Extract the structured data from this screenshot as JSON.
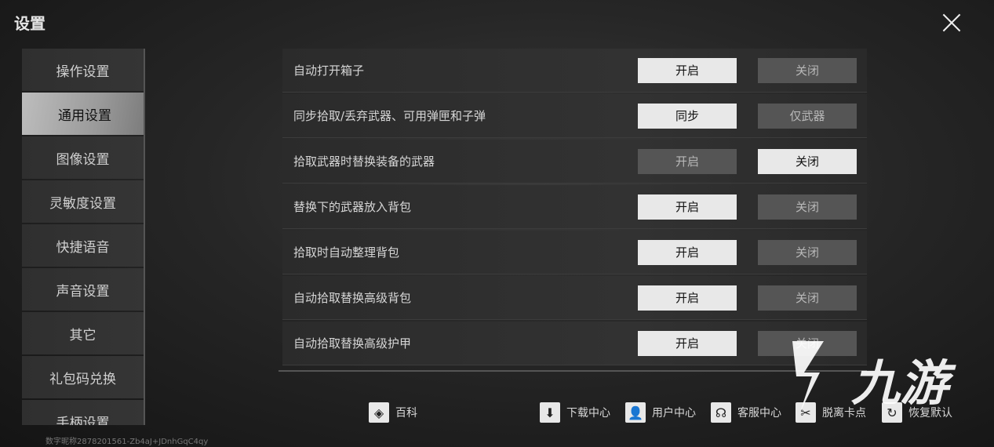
{
  "header": {
    "title": "设置"
  },
  "sidebar": {
    "items": [
      {
        "label": "操作设置"
      },
      {
        "label": "通用设置"
      },
      {
        "label": "图像设置"
      },
      {
        "label": "灵敏度设置"
      },
      {
        "label": "快捷语音"
      },
      {
        "label": "声音设置"
      },
      {
        "label": "其它"
      },
      {
        "label": "礼包码兑换"
      },
      {
        "label": "手柄设置"
      }
    ]
  },
  "settings": [
    {
      "label": "自动打开箱子",
      "option_a": "开启",
      "option_b": "关闭",
      "selected": "a"
    },
    {
      "label": "同步拾取/丢弃武器、可用弹匣和子弹",
      "option_a": "同步",
      "option_b": "仅武器",
      "selected": "a"
    },
    {
      "label": "拾取武器时替换装备的武器",
      "option_a": "开启",
      "option_b": "关闭",
      "selected": "b"
    },
    {
      "label": "替换下的武器放入背包",
      "option_a": "开启",
      "option_b": "关闭",
      "selected": "a"
    },
    {
      "label": "拾取时自动整理背包",
      "option_a": "开启",
      "option_b": "关闭",
      "selected": "a"
    },
    {
      "label": "自动拾取替换高级背包",
      "option_a": "开启",
      "option_b": "关闭",
      "selected": "a"
    },
    {
      "label": "自动拾取替换高级护甲",
      "option_a": "开启",
      "option_b": "关闭",
      "selected": "a"
    }
  ],
  "footer": {
    "wiki": "百科",
    "download": "下载中心",
    "user": "用户中心",
    "support": "客服中心",
    "unstuck": "脱离卡点",
    "reset": "恢复默认"
  },
  "id_text": "数字昵称2878201561-Zb4aJ+JDnhGqC4qy",
  "logo_text": "九游",
  "colors": {
    "active_option": "#e8e8e8",
    "inactive_option": "#555555",
    "accent": "#ffffff"
  }
}
